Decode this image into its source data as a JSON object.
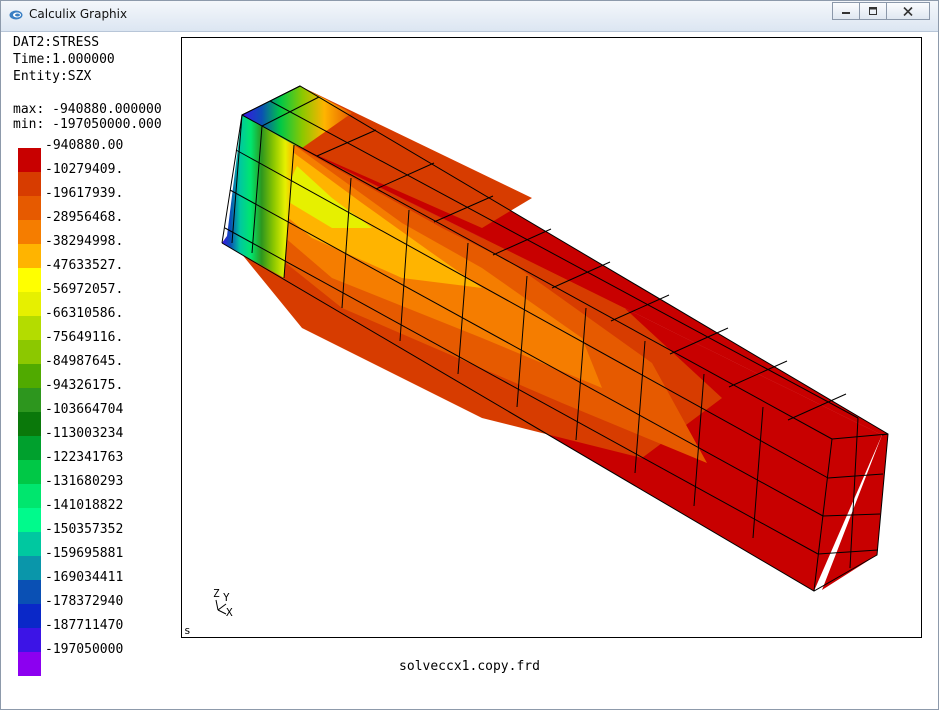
{
  "window": {
    "title": "Calculix Graphix",
    "icon": "calculix-app-icon"
  },
  "info": {
    "dataset": "DAT2:STRESS",
    "time": "Time:1.000000",
    "entity": "Entity:SZX",
    "max": "max: -940880.000000",
    "min": "min: -197050000.000"
  },
  "legend": [
    {
      "label": "-940880.00",
      "color": "#c80000"
    },
    {
      "label": "-10279409.",
      "color": "#d73c00"
    },
    {
      "label": "-19617939.",
      "color": "#e65a00"
    },
    {
      "label": "-28956468.",
      "color": "#f57d00"
    },
    {
      "label": "-38294998.",
      "color": "#ffb400"
    },
    {
      "label": "-47633527.",
      "color": "#ffff00"
    },
    {
      "label": "-56972057.",
      "color": "#e6f000"
    },
    {
      "label": "-66310586.",
      "color": "#b4dc00"
    },
    {
      "label": "-75649116.",
      "color": "#8cc800"
    },
    {
      "label": "-84987645.",
      "color": "#50aa00"
    },
    {
      "label": "-94326175.",
      "color": "#2d961e"
    },
    {
      "label": "-103664704",
      "color": "#0a780a"
    },
    {
      "label": "-113003234",
      "color": "#00a02d"
    },
    {
      "label": "-122341763",
      "color": "#00c846"
    },
    {
      "label": "-131680293",
      "color": "#00e66e"
    },
    {
      "label": "-141018822",
      "color": "#00fa8c"
    },
    {
      "label": "-150357352",
      "color": "#00c8a0"
    },
    {
      "label": "-159695881",
      "color": "#0a96aa"
    },
    {
      "label": "-169034411",
      "color": "#0a50b4"
    },
    {
      "label": "-178372940",
      "color": "#0a28c8"
    },
    {
      "label": "-187711470",
      "color": "#3c14e6"
    },
    {
      "label": "-197050000",
      "color": "#8c00f0"
    }
  ],
  "viewport": {
    "corner_label": "s",
    "axes": {
      "z": "Z",
      "y": "Y",
      "x": "X"
    }
  },
  "filename": "solveccx1.copy.frd"
}
